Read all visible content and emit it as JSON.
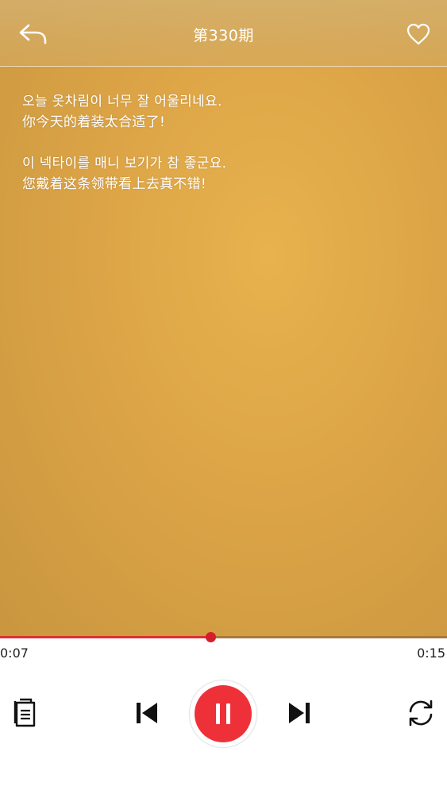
{
  "header": {
    "title": "第330期",
    "back_icon": "back-arrow-icon",
    "favorite_icon": "heart-outline-icon"
  },
  "lyrics": [
    {
      "korean": "오늘 옷차림이 너무 잘 어울리네요.",
      "chinese": "你今天的着装太合适了!"
    },
    {
      "korean": "이 넥타이를 매니 보기가 참 좋군요.",
      "chinese": "您戴着这条领带看上去真不错!"
    }
  ],
  "player": {
    "current_time": "0:07",
    "total_time": "0:15",
    "progress": 0.47,
    "state": "playing",
    "accent_color": "#ee3139"
  },
  "controls": {
    "playlist_icon": "document-list-icon",
    "prev_icon": "skip-previous-icon",
    "pause_icon": "pause-icon",
    "next_icon": "skip-next-icon",
    "repeat_icon": "repeat-icon"
  }
}
